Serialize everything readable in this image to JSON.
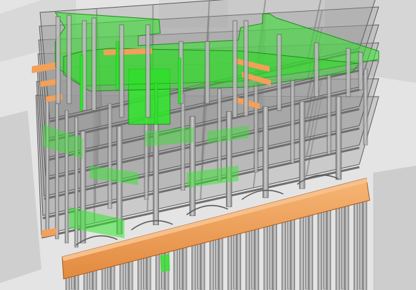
{
  "scene": {
    "palette": {
      "background": "#e7e7e7",
      "surrounding_blocks": "#d3d3d3",
      "concrete_frame": "#8f8f8f",
      "column_light": "#c4c4c4",
      "column_dark": "#6f6f6f",
      "green_highlight": "#2ee62a",
      "green_dark": "#1fa81c",
      "transfer_slab_orange": "#f2a05a",
      "orange_dark": "#c9702e"
    },
    "elements": {
      "tower_floors_count": 7,
      "upper_green_floors_count": 3,
      "piles_visible": true
    }
  }
}
